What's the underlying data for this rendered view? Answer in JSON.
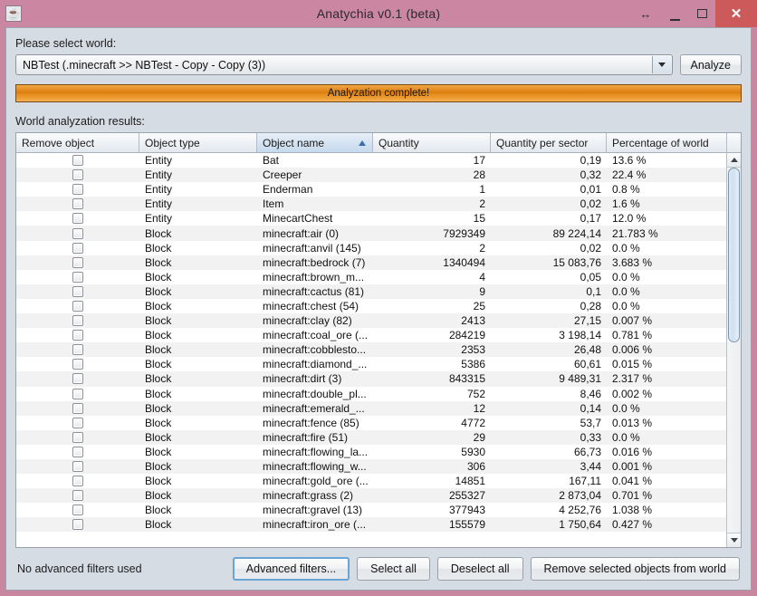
{
  "window": {
    "title": "Anatychia v0.1 (beta)",
    "app_icon": "java-coffee-cup-icon",
    "controls": {
      "restore_arrows": "↔",
      "minimize": "minimize-icon",
      "maximize": "maximize-icon",
      "close": "✕"
    },
    "frame_color": "#c8869f",
    "panel_color": "#d6dce4"
  },
  "select_world": {
    "label": "Please select world:",
    "combo_value": "NBTest (.minecraft >> NBTest - Copy - Copy (3))",
    "analyze_label": "Analyze"
  },
  "progress": {
    "text": "Analyzation complete!",
    "percent": 100,
    "color": "#e0870f"
  },
  "results": {
    "label": "World analyzation results:",
    "sorted_column": "Object name",
    "sort_direction": "ascending",
    "columns": [
      "Remove object",
      "Object type",
      "Object name",
      "Quantity",
      "Quantity per sector",
      "Percentage of world"
    ],
    "rows": [
      {
        "type": "Entity",
        "name": "Bat",
        "qty": "17",
        "qps": "0,19",
        "pct": "13.6 %"
      },
      {
        "type": "Entity",
        "name": "Creeper",
        "qty": "28",
        "qps": "0,32",
        "pct": "22.4 %"
      },
      {
        "type": "Entity",
        "name": "Enderman",
        "qty": "1",
        "qps": "0,01",
        "pct": "0.8 %"
      },
      {
        "type": "Entity",
        "name": "Item",
        "qty": "2",
        "qps": "0,02",
        "pct": "1.6 %"
      },
      {
        "type": "Entity",
        "name": "MinecartChest",
        "qty": "15",
        "qps": "0,17",
        "pct": "12.0 %"
      },
      {
        "type": "Block",
        "name": "minecraft:air (0)",
        "qty": "7929349",
        "qps": "89 224,14",
        "pct": "21.783 %"
      },
      {
        "type": "Block",
        "name": "minecraft:anvil (145)",
        "qty": "2",
        "qps": "0,02",
        "pct": "0.0 %"
      },
      {
        "type": "Block",
        "name": "minecraft:bedrock (7)",
        "qty": "1340494",
        "qps": "15 083,76",
        "pct": "3.683 %"
      },
      {
        "type": "Block",
        "name": "minecraft:brown_m...",
        "qty": "4",
        "qps": "0,05",
        "pct": "0.0 %"
      },
      {
        "type": "Block",
        "name": "minecraft:cactus (81)",
        "qty": "9",
        "qps": "0,1",
        "pct": "0.0 %"
      },
      {
        "type": "Block",
        "name": "minecraft:chest (54)",
        "qty": "25",
        "qps": "0,28",
        "pct": "0.0 %"
      },
      {
        "type": "Block",
        "name": "minecraft:clay (82)",
        "qty": "2413",
        "qps": "27,15",
        "pct": "0.007 %"
      },
      {
        "type": "Block",
        "name": "minecraft:coal_ore (...",
        "qty": "284219",
        "qps": "3 198,14",
        "pct": "0.781 %"
      },
      {
        "type": "Block",
        "name": "minecraft:cobblesto...",
        "qty": "2353",
        "qps": "26,48",
        "pct": "0.006 %"
      },
      {
        "type": "Block",
        "name": "minecraft:diamond_...",
        "qty": "5386",
        "qps": "60,61",
        "pct": "0.015 %"
      },
      {
        "type": "Block",
        "name": "minecraft:dirt (3)",
        "qty": "843315",
        "qps": "9 489,31",
        "pct": "2.317 %"
      },
      {
        "type": "Block",
        "name": "minecraft:double_pl...",
        "qty": "752",
        "qps": "8,46",
        "pct": "0.002 %"
      },
      {
        "type": "Block",
        "name": "minecraft:emerald_...",
        "qty": "12",
        "qps": "0,14",
        "pct": "0.0 %"
      },
      {
        "type": "Block",
        "name": "minecraft:fence (85)",
        "qty": "4772",
        "qps": "53,7",
        "pct": "0.013 %"
      },
      {
        "type": "Block",
        "name": "minecraft:fire (51)",
        "qty": "29",
        "qps": "0,33",
        "pct": "0.0 %"
      },
      {
        "type": "Block",
        "name": "minecraft:flowing_la...",
        "qty": "5930",
        "qps": "66,73",
        "pct": "0.016 %"
      },
      {
        "type": "Block",
        "name": "minecraft:flowing_w...",
        "qty": "306",
        "qps": "3,44",
        "pct": "0.001 %"
      },
      {
        "type": "Block",
        "name": "minecraft:gold_ore (...",
        "qty": "14851",
        "qps": "167,11",
        "pct": "0.041 %"
      },
      {
        "type": "Block",
        "name": "minecraft:grass (2)",
        "qty": "255327",
        "qps": "2 873,04",
        "pct": "0.701 %"
      },
      {
        "type": "Block",
        "name": "minecraft:gravel (13)",
        "qty": "377943",
        "qps": "4 252,76",
        "pct": "1.038 %"
      },
      {
        "type": "Block",
        "name": "minecraft:iron_ore (...",
        "qty": "155579",
        "qps": "1 750,64",
        "pct": "0.427 %"
      }
    ]
  },
  "footer": {
    "status": "No advanced filters used",
    "advanced_filters_label": "Advanced filters...",
    "select_all_label": "Select all",
    "deselect_all_label": "Deselect all",
    "remove_selected_label": "Remove selected objects from world"
  }
}
